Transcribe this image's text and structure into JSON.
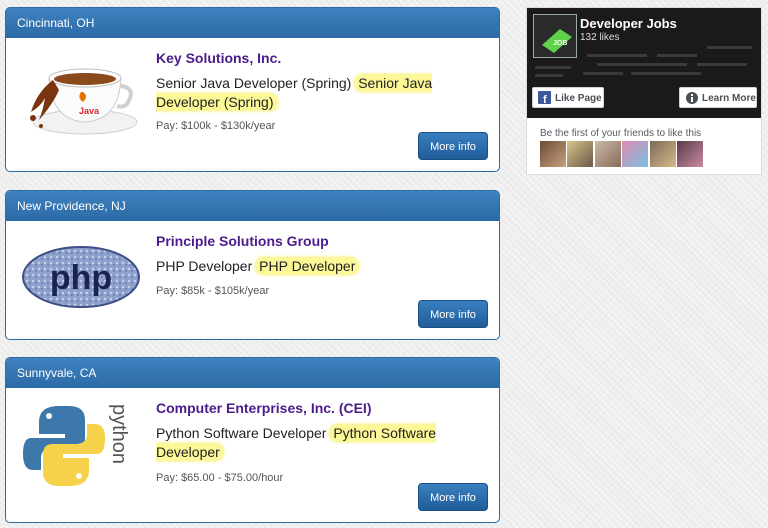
{
  "jobs": [
    {
      "location": "Cincinnati, OH",
      "logo_icon": "java-coffee-cup-icon",
      "logo_text": "Java",
      "company": "Key Solutions, Inc.",
      "title_plain": "Senior Java Developer (Spring)",
      "title_highlight": "Senior Java Developer (Spring)",
      "pay": "Pay: $100k - $130k/year",
      "button": "More info"
    },
    {
      "location": "New Providence, NJ",
      "logo_icon": "php-logo-icon",
      "logo_text": "php",
      "company": "Principle Solutions Group",
      "title_plain": "PHP Developer",
      "title_highlight": "PHP Developer",
      "pay": "Pay: $85k - $105k/year",
      "button": "More info"
    },
    {
      "location": "Sunnyvale, CA",
      "logo_icon": "python-logo-icon",
      "logo_text": "python",
      "company": "Computer Enterprises, Inc. (CEI)",
      "title_plain": "Python Software Developer",
      "title_highlight": "Python Software Developer",
      "pay": "Pay: $65.00 - $75.00/hour",
      "button": "More info"
    }
  ],
  "fb_widget": {
    "page_name": "Developer Jobs",
    "likes": "132 likes",
    "avatar_text": "JOB",
    "like_button": "Like Page",
    "learn_button": "Learn More",
    "friends_text": "Be the first of your friends to like this"
  },
  "colors": {
    "header_blue": "#2f6aa3",
    "company_purple": "#4b1b8c",
    "highlight_yellow": "#fcf797",
    "facebook_blue": "#3b5998"
  }
}
